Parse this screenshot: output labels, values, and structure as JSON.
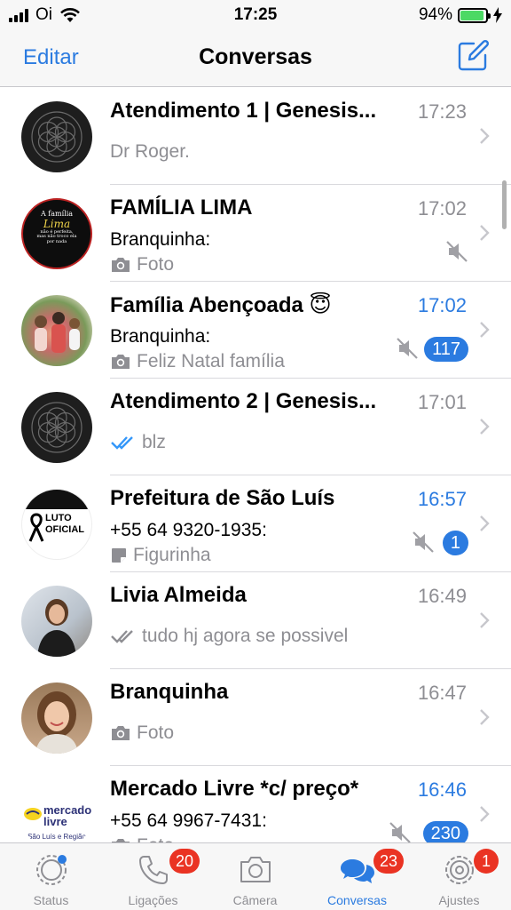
{
  "status_bar": {
    "carrier": "Oi",
    "time": "17:25",
    "battery": "94%",
    "battery_level": 0.94
  },
  "nav": {
    "edit_label": "Editar",
    "title": "Conversas",
    "compose_icon": "compose-icon"
  },
  "chats": [
    {
      "name": "Atendimento 1 | Genesis...",
      "time": "17:23",
      "time_highlight": false,
      "sender": "",
      "preview": "Dr Roger.",
      "preview_icon": "",
      "muted": false,
      "unread": ""
    },
    {
      "name": "FAMÍLIA LIMA",
      "time": "17:02",
      "time_highlight": false,
      "sender": "Branquinha:",
      "preview": "Foto",
      "preview_icon": "camera-icon",
      "muted": true,
      "unread": ""
    },
    {
      "name": "Família Abençoada 😇",
      "time": "17:02",
      "time_highlight": true,
      "sender": "Branquinha:",
      "preview": "Feliz Natal família",
      "preview_icon": "camera-icon",
      "muted": true,
      "unread": "117"
    },
    {
      "name": "Atendimento 2 | Genesis...",
      "time": "17:01",
      "time_highlight": false,
      "sender": "",
      "preview": "blz",
      "preview_icon": "double-check-blue-icon",
      "muted": false,
      "unread": ""
    },
    {
      "name": "Prefeitura de São Luís",
      "time": "16:57",
      "time_highlight": true,
      "sender": "+55 64 9320-1935:",
      "preview": "Figurinha",
      "preview_icon": "sticker-icon",
      "muted": true,
      "unread": "1"
    },
    {
      "name": "Livia Almeida",
      "time": "16:49",
      "time_highlight": false,
      "sender": "",
      "preview": "tudo hj agora se possivel",
      "preview_icon": "double-check-gray-icon",
      "muted": false,
      "unread": ""
    },
    {
      "name": "Branquinha",
      "time": "16:47",
      "time_highlight": false,
      "sender": "",
      "preview": "Foto",
      "preview_icon": "camera-icon",
      "muted": false,
      "unread": ""
    },
    {
      "name": "Mercado Livre *c/ preço*",
      "time": "16:46",
      "time_highlight": true,
      "sender": "+55 64 9967-7431:",
      "preview": "Foto",
      "preview_icon": "camera-icon",
      "muted": true,
      "unread": "230"
    }
  ],
  "avatars": {
    "familia_lima": {
      "line1": "A família",
      "line2": "Lima",
      "line3": "não é perfeita,",
      "line4": "mas não troco ela",
      "line5": "por nada"
    },
    "prefeitura": {
      "line1": "LUTO",
      "line2": "OFICIAL"
    },
    "mercado": {
      "line1": "mercado",
      "line2": "livre",
      "line3": "São Luís e Região"
    }
  },
  "tabs": [
    {
      "label": "Status",
      "icon": "status-icon",
      "badge": "",
      "active": false
    },
    {
      "label": "Ligações",
      "icon": "phone-icon",
      "badge": "20",
      "active": false
    },
    {
      "label": "Câmera",
      "icon": "camera-icon",
      "badge": "",
      "active": false
    },
    {
      "label": "Conversas",
      "icon": "chat-bubbles-icon",
      "badge": "23",
      "active": true
    },
    {
      "label": "Ajustes",
      "icon": "gear-icon",
      "badge": "1",
      "active": false
    }
  ],
  "colors": {
    "accent": "#2b7be0",
    "badge_red": "#ea3323",
    "secondary_text": "#8e8e93",
    "battery_green": "#4cd964"
  }
}
